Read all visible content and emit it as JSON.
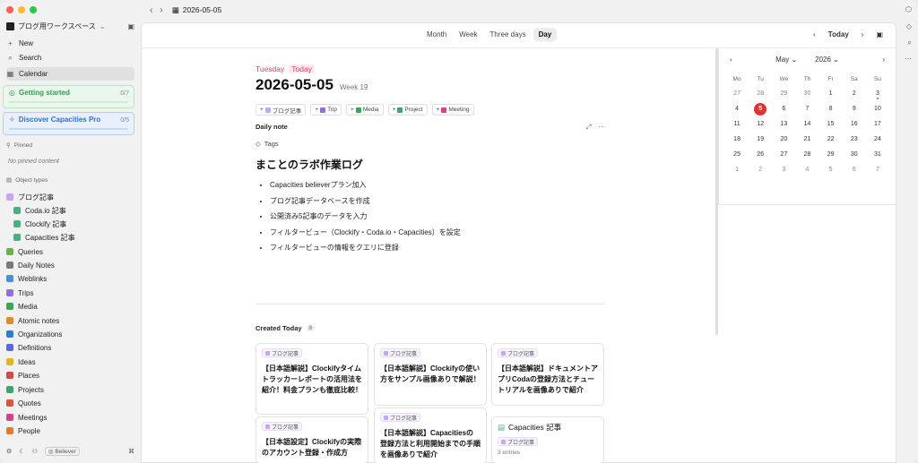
{
  "window": {
    "traffic_colors": [
      "#ff5f57",
      "#febc2e",
      "#28c840"
    ]
  },
  "sidebar": {
    "workspace": "ブログ用ワークスペース",
    "new_label": "New",
    "search_label": "Search",
    "calendar_label": "Calendar",
    "getting_started": {
      "label": "Getting started",
      "count": "0/7",
      "color": "#2e9e4f"
    },
    "discover": {
      "label": "Discover Capacities Pro",
      "count": "0/5",
      "color": "#2d6fd6"
    },
    "pinned_header": "Pinned",
    "pinned_empty": "No pinned content",
    "object_types_header": "Object types",
    "items": [
      {
        "label": "ブログ記事",
        "icon": "blog-icon",
        "color": "#c9a6f2",
        "indent": false
      },
      {
        "label": "Coda.io 記事",
        "icon": "table-icon",
        "color": "#4caf80",
        "indent": true
      },
      {
        "label": "Clockify 記事",
        "icon": "table-icon",
        "color": "#4caf80",
        "indent": true
      },
      {
        "label": "Capacities 記事",
        "icon": "table-icon",
        "color": "#4caf80",
        "indent": true
      },
      {
        "label": "Queries",
        "icon": "queries-icon",
        "color": "#6fae4e",
        "indent": false
      },
      {
        "label": "Daily Notes",
        "icon": "calendar-icon",
        "color": "#7a7a7a",
        "indent": false
      },
      {
        "label": "Weblinks",
        "icon": "globe-icon",
        "color": "#4a8fdc",
        "indent": false
      },
      {
        "label": "Trips",
        "icon": "trips-icon",
        "color": "#8e6fdc",
        "indent": false
      },
      {
        "label": "Media",
        "icon": "media-icon",
        "color": "#34a853",
        "indent": false
      },
      {
        "label": "Atomic notes",
        "icon": "atom-icon",
        "color": "#e38a2b",
        "indent": false
      },
      {
        "label": "Organizations",
        "icon": "org-icon",
        "color": "#2f7fd0",
        "indent": false
      },
      {
        "label": "Definitions",
        "icon": "book-icon",
        "color": "#5b6bd6",
        "indent": false
      },
      {
        "label": "Ideas",
        "icon": "bulb-icon",
        "color": "#e2b51a",
        "indent": false
      },
      {
        "label": "Places",
        "icon": "pin-icon",
        "color": "#d44b3f",
        "indent": false
      },
      {
        "label": "Projects",
        "icon": "target-icon",
        "color": "#3aa86a",
        "indent": false
      },
      {
        "label": "Quotes",
        "icon": "quote-icon",
        "color": "#e0523e",
        "indent": false
      },
      {
        "label": "Meetings",
        "icon": "meeting-icon",
        "color": "#d9428a",
        "indent": false
      },
      {
        "label": "People",
        "icon": "person-icon",
        "color": "#e07b2e",
        "indent": false
      }
    ],
    "bottom": {
      "believer": "Believer"
    }
  },
  "topbar": {
    "date": "2026-05-05"
  },
  "views": {
    "tabs": [
      "Month",
      "Week",
      "Three days",
      "Day"
    ],
    "selected": "Day",
    "today_label": "Today"
  },
  "note": {
    "weekday": "Tuesday",
    "today_chip": "Today",
    "date": "2026-05-05",
    "week": "Week 19",
    "object_chips": [
      {
        "label": "ブログ記事",
        "color": "#c9a6f2"
      },
      {
        "label": "Trip",
        "color": "#8e6fdc"
      },
      {
        "label": "Media",
        "color": "#34a853"
      },
      {
        "label": "Project",
        "color": "#3aa86a"
      },
      {
        "label": "Meeting",
        "color": "#d9428a"
      }
    ],
    "section": "Daily note",
    "tags_label": "Tags",
    "heading": "まことのラボ作業ログ",
    "bullets": [
      "Capacities believerプラン加入",
      "ブログ記事データベースを作成",
      "公開済み5記事のデータを入力",
      "フィルタービュー（Clockify・Coda.io・Capacities）を設定",
      "フィルタービューの情報をクエリに登録"
    ]
  },
  "created": {
    "title": "Created Today",
    "count": "8",
    "cards": [
      {
        "chip": "ブログ記事",
        "title": "【日本語解説】Clockifyタイムトラッカーレポートの活用法を紹介！料金プランも徹底比較！"
      },
      {
        "chip": "ブログ記事",
        "title": "【日本語解説】Clockifyの使い方をサンプル画像ありで解説！"
      },
      {
        "chip": "ブログ記事",
        "title": "【日本語解説】ドキュメントアプリCodaの登録方法とチュートリアルを画像ありで紹介"
      },
      {
        "chip": "ブログ記事",
        "title": "【日本語設定】Clockifyの実際のアカウント登録・作成方"
      },
      {
        "chip": "ブログ記事",
        "title": "【日本語解説】Capacitiesの登録方法と利用開始までの手順を画像ありで紹介"
      },
      {
        "chip": "ブログ記事",
        "title": "Capacities 記事",
        "sub": "3 entries"
      }
    ]
  },
  "mini_calendar": {
    "month": "May",
    "year": "2026",
    "weekdays": [
      "Mo",
      "Tu",
      "We",
      "Th",
      "Fr",
      "Sa",
      "Su"
    ],
    "weeks": [
      [
        "27",
        "28",
        "29",
        "30",
        "1",
        "2",
        "3"
      ],
      [
        "4",
        "5",
        "6",
        "7",
        "8",
        "9",
        "10"
      ],
      [
        "11",
        "12",
        "13",
        "14",
        "15",
        "16",
        "17"
      ],
      [
        "18",
        "19",
        "20",
        "21",
        "22",
        "23",
        "24"
      ],
      [
        "25",
        "26",
        "27",
        "28",
        "29",
        "30",
        "31"
      ],
      [
        "1",
        "2",
        "3",
        "4",
        "5",
        "6",
        "7"
      ]
    ],
    "today": "5",
    "accent": "#e5322e"
  }
}
